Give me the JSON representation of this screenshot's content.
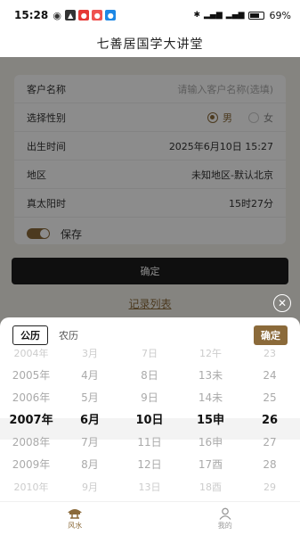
{
  "status": {
    "time": "15:28",
    "battery": "69%",
    "battery_level": 0.69
  },
  "header": {
    "title": "七善居国学大讲堂"
  },
  "form": {
    "name_label": "客户名称",
    "name_placeholder": "请输入客户名称(选填)",
    "gender_label": "选择性别",
    "gender_male": "男",
    "gender_female": "女",
    "birth_label": "出生时间",
    "birth_value": "2025年6月10日 15:27",
    "region_label": "地区",
    "region_value": "未知地区-默认北京",
    "solar_label": "真太阳时",
    "solar_value": "15时27分",
    "save_label": "保存"
  },
  "confirm_button": "确定",
  "records_link": "记录列表",
  "picker": {
    "tab_solar": "公历",
    "tab_lunar": "农历",
    "ok_label": "确定",
    "years": [
      "2004年",
      "2005年",
      "2006年",
      "2007年",
      "2008年",
      "2009年",
      "2010年"
    ],
    "months": [
      "3月",
      "4月",
      "5月",
      "6月",
      "7月",
      "8月",
      "9月"
    ],
    "days": [
      "7日",
      "8日",
      "9日",
      "10日",
      "11日",
      "12日",
      "13日"
    ],
    "hours": [
      "12午",
      "13未",
      "14未",
      "15申",
      "16申",
      "17酉",
      "18酉"
    ],
    "minutes": [
      "23",
      "24",
      "25",
      "26",
      "27",
      "28",
      "29"
    ]
  },
  "tabbar": {
    "fengshui": "风水",
    "mine": "我的"
  },
  "colors": {
    "accent": "#8b6a3a",
    "dark_button": "#1c1c1c"
  }
}
